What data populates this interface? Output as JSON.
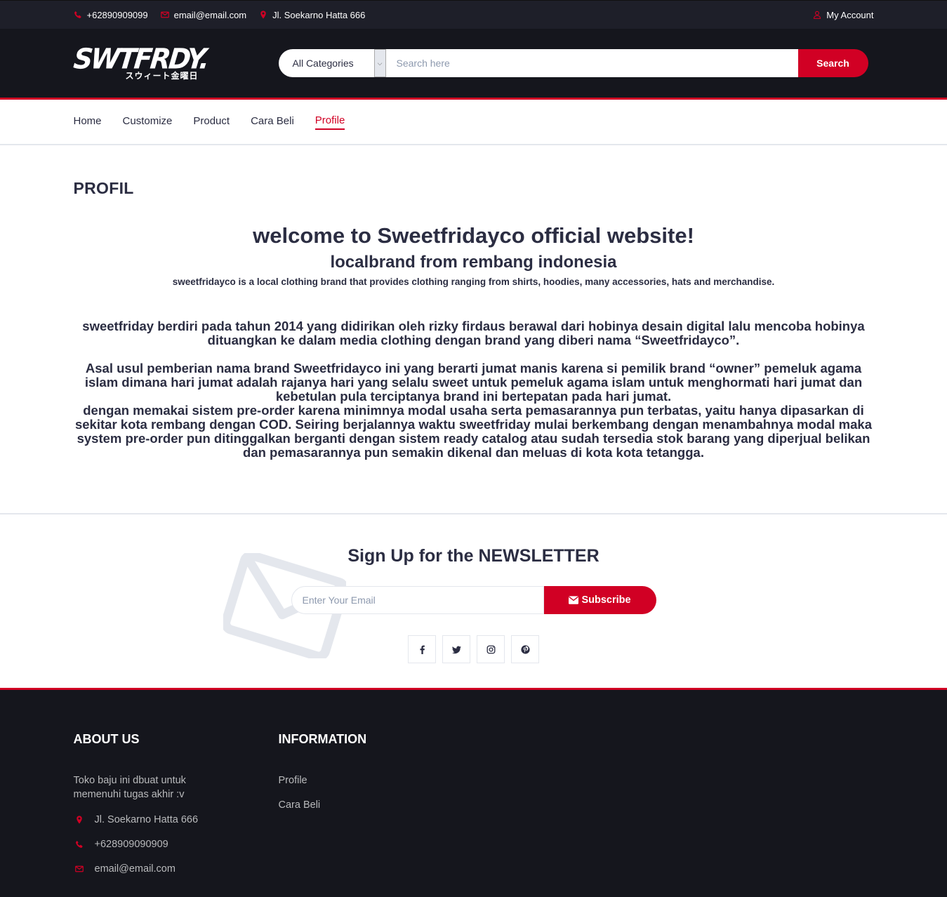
{
  "top_bar": {
    "phone": "+62890909099",
    "email": "email@email.com",
    "address": "Jl. Soekarno Hatta 666",
    "account": "My Account"
  },
  "header": {
    "logo_text": "SWTFRDY.",
    "logo_sub": "スウィート金曜日",
    "category_selected": "All Categories",
    "search_placeholder": "Search here",
    "search_button": "Search"
  },
  "nav": {
    "items": [
      {
        "label": "Home",
        "active": false
      },
      {
        "label": "Customize",
        "active": false
      },
      {
        "label": "Product",
        "active": false
      },
      {
        "label": "Cara Beli",
        "active": false
      },
      {
        "label": "Profile",
        "active": true
      }
    ]
  },
  "profile": {
    "heading": "PROFIL",
    "welcome": "welcome to Sweetfridayco official website!",
    "subtitle": "localbrand from rembang indonesia",
    "intro": "sweetfridayco is a local clothing brand that provides clothing ranging from shirts, hoodies, many accessories, hats and merchandise.",
    "paragraph1": "sweetfriday berdiri pada tahun 2014 yang didirikan oleh rizky firdaus berawal dari hobinya desain digital lalu mencoba hobinya dituangkan ke dalam media clothing dengan brand yang diberi nama “Sweetfridayco”.",
    "paragraph2": "Asal usul pemberian nama brand Sweetfridayco ini yang berarti jumat manis karena si pemilik brand “owner” pemeluk agama islam dimana hari jumat adalah rajanya hari yang selalu sweet untuk pemeluk agama islam untuk menghormati hari jumat dan kebetulan pula terciptanya brand ini bertepatan pada hari jumat.",
    "paragraph3": "dengan memakai sistem pre-order karena minimnya modal usaha serta pemasarannya pun terbatas, yaitu hanya dipasarkan di sekitar kota rembang dengan COD. Seiring berjalannya waktu sweetfriday mulai berkembang dengan menambahnya modal maka system pre-order pun ditinggalkan berganti dengan sistem ready catalog atau sudah tersedia stok barang yang diperjual belikan dan pemasarannya pun semakin dikenal dan meluas di kota kota tetangga."
  },
  "newsletter": {
    "title_prefix": "Sign Up for the",
    "title_bold": "NEWSLETTER",
    "email_placeholder": "Enter Your Email",
    "subscribe_button": "Subscribe",
    "social": [
      "facebook-icon",
      "twitter-icon",
      "instagram-icon",
      "pinterest-icon"
    ]
  },
  "footer": {
    "about_title": "ABOUT US",
    "about_text": "Toko baju ini dbuat untuk memenuhi tugas akhir :v",
    "address": "Jl. Soekarno Hatta 666",
    "phone": "+628909090909",
    "email": "email@email.com",
    "info_title": "INFORMATION",
    "info_links": [
      "Profile",
      "Cara Beli"
    ]
  },
  "colors": {
    "accent": "#d10024",
    "dark": "#15161d",
    "topbar": "#1e1f29",
    "text": "#2b2d42"
  }
}
